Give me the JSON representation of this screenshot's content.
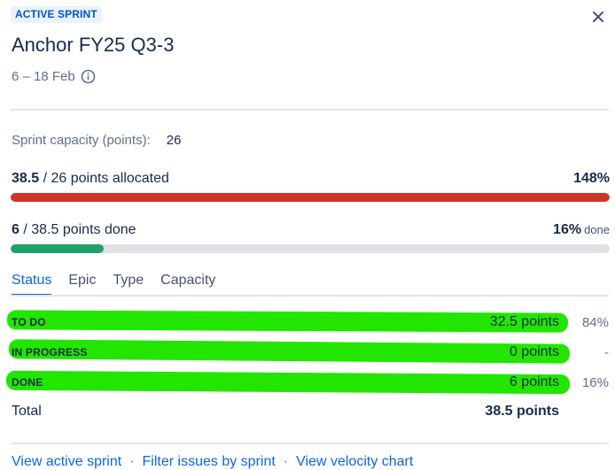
{
  "header": {
    "badge": "ACTIVE SPRINT",
    "title": "Anchor FY25 Q3-3",
    "dates": "6 – 18 Feb"
  },
  "capacity": {
    "label": "Sprint capacity (points):",
    "value": "26"
  },
  "allocated": {
    "amount": "38.5",
    "suffix": " / 26 points allocated",
    "percent": "148%",
    "fill_fraction": 1.0,
    "bar_color": "#c9372c"
  },
  "done": {
    "amount": "6",
    "suffix": " / 38.5 points done",
    "percent": "16%",
    "percent_suffix": "done",
    "fill_fraction": 0.156,
    "bar_color": "#22a06b"
  },
  "tabs": [
    {
      "label": "Status",
      "active": true
    },
    {
      "label": "Epic",
      "active": false
    },
    {
      "label": "Type",
      "active": false
    },
    {
      "label": "Capacity",
      "active": false
    }
  ],
  "status_rows": [
    {
      "name": "TO DO",
      "points": "32.5 points",
      "percent": "84%"
    },
    {
      "name": "IN PROGRESS",
      "points": "0 points",
      "percent": "-"
    },
    {
      "name": "DONE",
      "points": "6 points",
      "percent": "16%"
    }
  ],
  "total": {
    "label": "Total",
    "points": "38.5 points"
  },
  "links": {
    "view_sprint": "View active sprint",
    "filter": "Filter issues by sprint",
    "velocity": "View velocity chart",
    "separator": "·"
  },
  "colors": {
    "accent": "#0c66e4",
    "highlight": "#22e600"
  }
}
